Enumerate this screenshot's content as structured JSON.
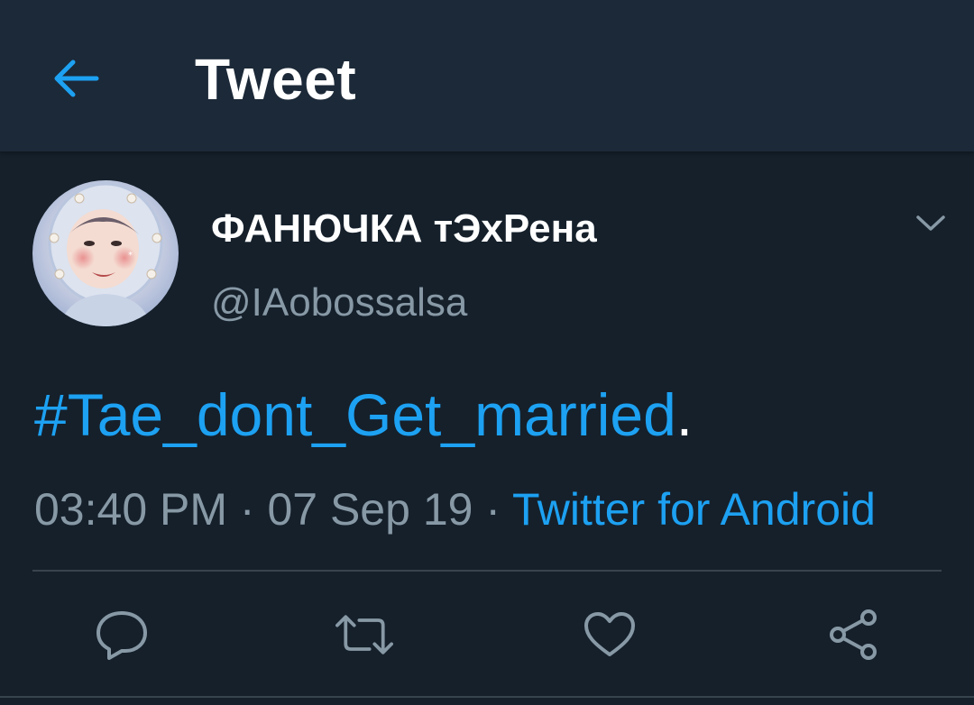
{
  "header": {
    "title": "Tweet",
    "back_icon": "arrow-left-icon"
  },
  "tweet": {
    "author": {
      "display_name": "ФАНЮЧКА тЭхРена",
      "handle": "@IAobossalsa"
    },
    "text": {
      "hashtag": "#Tae_dont_Get_married",
      "trailing": "."
    },
    "meta": {
      "time": "03:40 PM",
      "separator": " · ",
      "date": "07 Sep 19",
      "source": "Twitter for Android"
    },
    "actions": [
      {
        "name": "reply",
        "icon": "reply-icon"
      },
      {
        "name": "retweet",
        "icon": "retweet-icon"
      },
      {
        "name": "like",
        "icon": "heart-icon"
      },
      {
        "name": "share",
        "icon": "share-icon"
      }
    ]
  },
  "colors": {
    "background": "#15202b",
    "header_background": "#1c2938",
    "accent": "#1da1f2",
    "secondary_text": "#8899a6",
    "divider": "#38444d"
  }
}
